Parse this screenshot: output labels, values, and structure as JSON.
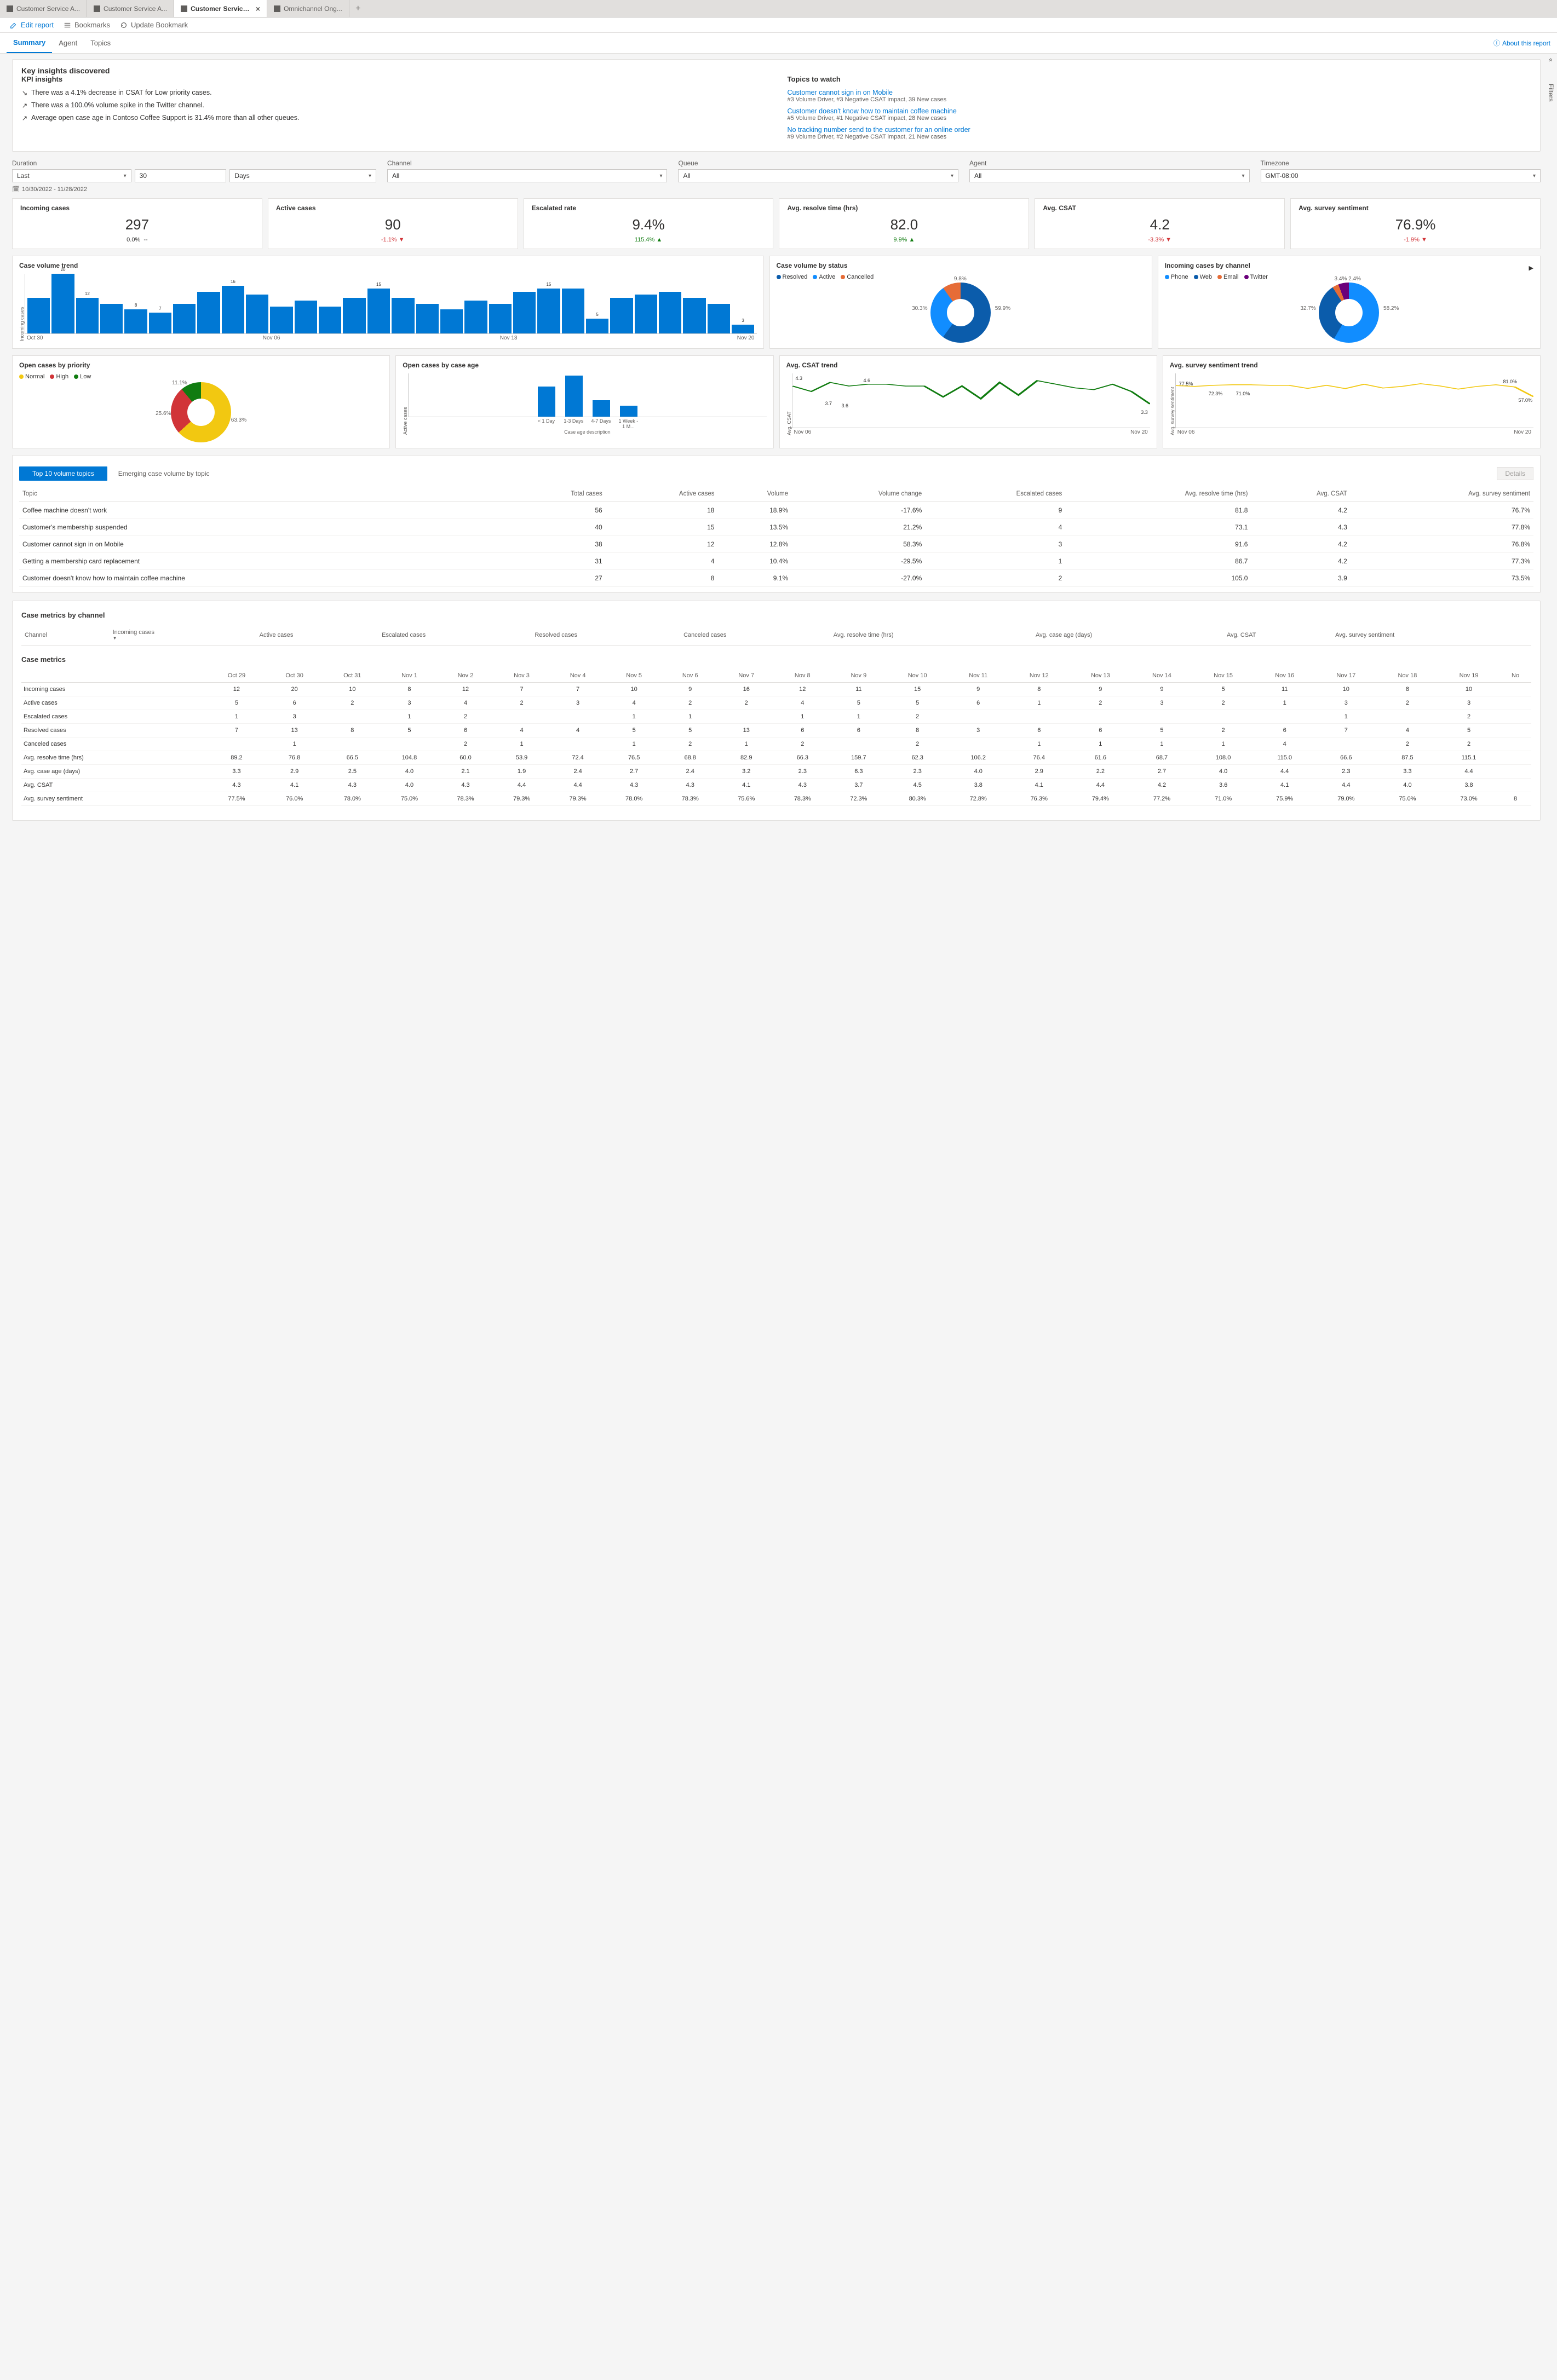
{
  "tabs": [
    {
      "label": "Customer Service A..."
    },
    {
      "label": "Customer Service A..."
    },
    {
      "label": "Customer Service historic...",
      "active": true
    },
    {
      "label": "Omnichannel Ong..."
    }
  ],
  "toolbar": {
    "edit": "Edit report",
    "bookmarks": "Bookmarks",
    "update": "Update Bookmark"
  },
  "subtabs": [
    "Summary",
    "Agent",
    "Topics"
  ],
  "about": "About this report",
  "insights": {
    "title": "Key insights discovered",
    "kpi_heading": "KPI insights",
    "kpis": [
      {
        "dir": "down",
        "text": "There was a 4.1% decrease in CSAT for Low priority cases."
      },
      {
        "dir": "up",
        "text": "There was a 100.0% volume spike in the Twitter channel."
      },
      {
        "dir": "up",
        "text": "Average open case age in Contoso Coffee Support is 31.4% more than all other queues."
      }
    ],
    "topics_heading": "Topics to watch",
    "topics": [
      {
        "title": "Customer cannot sign in on Mobile",
        "sub": "#3 Volume Driver, #3 Negative CSAT impact, 39 New cases"
      },
      {
        "title": "Customer doesn't know how to maintain coffee machine",
        "sub": "#5 Volume Driver, #1 Negative CSAT impact, 28 New cases"
      },
      {
        "title": "No tracking number send to the customer for an online order",
        "sub": "#9 Volume Driver, #2 Negative CSAT impact, 21 New cases"
      }
    ]
  },
  "filters": {
    "duration_label": "Duration",
    "duration_mode": "Last",
    "duration_value": "30",
    "duration_unit": "Days",
    "channel_label": "Channel",
    "channel_value": "All",
    "queue_label": "Queue",
    "queue_value": "All",
    "agent_label": "Agent",
    "agent_value": "All",
    "timezone_label": "Timezone",
    "timezone_value": "GMT-08:00",
    "range": "10/30/2022 - 11/28/2022"
  },
  "kpicards": [
    {
      "label": "Incoming cases",
      "value": "297",
      "delta": "0.0%",
      "deltaExtra": "--",
      "dir": "none"
    },
    {
      "label": "Active cases",
      "value": "90",
      "delta": "-1.1%",
      "dir": "down"
    },
    {
      "label": "Escalated rate",
      "value": "9.4%",
      "delta": "115.4%",
      "dir": "up"
    },
    {
      "label": "Avg. resolve time (hrs)",
      "value": "82.0",
      "delta": "9.9%",
      "dir": "up"
    },
    {
      "label": "Avg. CSAT",
      "value": "4.2",
      "delta": "-3.3%",
      "dir": "down"
    },
    {
      "label": "Avg. survey sentiment",
      "value": "76.9%",
      "delta": "-1.9%",
      "dir": "down"
    }
  ],
  "chart_data": {
    "case_volume_trend": {
      "type": "bar",
      "title": "Case volume trend",
      "ylabel": "Incoming cases",
      "ylim": [
        0,
        20
      ],
      "x_ticks": [
        "Oct 30",
        "Nov 06",
        "Nov 13",
        "Nov 20"
      ],
      "values": [
        12,
        20,
        12,
        10,
        8,
        7,
        10,
        14,
        16,
        13,
        9,
        11,
        9,
        12,
        15,
        12,
        10,
        8,
        11,
        10,
        14,
        15,
        15,
        5,
        12,
        13,
        14,
        12,
        10,
        3
      ],
      "labels_shown": {
        "1": "20",
        "2": "12",
        "5": "7",
        "8": "16",
        "14": "15",
        "21": "15",
        "23": "5",
        "29": "3",
        "4": "8"
      }
    },
    "case_volume_by_status": {
      "type": "pie",
      "title": "Case volume by status",
      "series": [
        {
          "name": "Resolved",
          "value": 59.9,
          "color": "#0b5cab"
        },
        {
          "name": "Active",
          "value": 30.3,
          "color": "#118dff"
        },
        {
          "name": "Cancelled",
          "value": 9.8,
          "color": "#e66c37"
        }
      ]
    },
    "incoming_by_channel": {
      "type": "pie",
      "title": "Incoming cases by channel",
      "series": [
        {
          "name": "Phone",
          "value": 58.2,
          "color": "#118dff"
        },
        {
          "name": "Web",
          "value": 32.7,
          "color": "#0b5cab"
        },
        {
          "name": "Email",
          "value": 3.4,
          "color": "#e66c37"
        },
        {
          "name": "Twitter",
          "value": 2.4,
          "color": "#6b007b"
        }
      ],
      "extra_label": "3.4%  2.4%"
    },
    "open_by_priority": {
      "type": "pie",
      "title": "Open cases by priority",
      "series": [
        {
          "name": "Normal",
          "value": 63.3,
          "color": "#f2c811"
        },
        {
          "name": "High",
          "value": 25.6,
          "color": "#d13438"
        },
        {
          "name": "Low",
          "value": 11.1,
          "color": "#107c10"
        }
      ]
    },
    "open_by_age": {
      "type": "bar",
      "title": "Open cases by case age",
      "ylabel": "Active cases",
      "ylim": [
        0,
        40
      ],
      "categories": [
        "< 1 Day",
        "1-3 Days",
        "4-7 Days",
        "1 Week - 1 M..."
      ],
      "values": [
        28,
        38,
        15,
        10
      ],
      "xlabel": "Case age description"
    },
    "csat_trend": {
      "type": "line",
      "title": "Avg. CSAT trend",
      "ylabel": "Avg. CSAT",
      "ylim": [
        2,
        5
      ],
      "x_ticks": [
        "Nov 06",
        "Nov 20"
      ],
      "annotations": [
        "4.3",
        "3.7",
        "3.6",
        "4.6",
        "3.3"
      ],
      "values": [
        4.3,
        4.0,
        4.5,
        4.3,
        4.4,
        4.4,
        4.3,
        4.3,
        3.7,
        4.3,
        3.6,
        4.5,
        3.8,
        4.6,
        4.4,
        4.2,
        4.1,
        4.4,
        4.0,
        3.3
      ]
    },
    "sentiment_trend": {
      "type": "line",
      "title": "Avg. survey sentiment trend",
      "ylabel": "Avg. survey sentiment",
      "ylim": [
        0,
        100
      ],
      "x_ticks": [
        "Nov 06",
        "Nov 20"
      ],
      "annotations": [
        "77.5%",
        "72.3%",
        "71.0%",
        "81.0%",
        "57.0%"
      ],
      "values": [
        77.5,
        76,
        78,
        79,
        79,
        78,
        78,
        72.3,
        78,
        72,
        80,
        73,
        76,
        81.0,
        77,
        71.0,
        76,
        79,
        75,
        57.0
      ]
    }
  },
  "topics_tabs": {
    "active": "Top 10 volume topics",
    "other": "Emerging case volume by topic",
    "details": "Details"
  },
  "topic_table": {
    "headers": [
      "Topic",
      "Total cases",
      "Active cases",
      "Volume",
      "Volume change",
      "Escalated cases",
      "Avg. resolve time (hrs)",
      "Avg. CSAT",
      "Avg. survey sentiment"
    ],
    "rows": [
      [
        "Coffee machine doesn't work",
        "56",
        "18",
        "18.9%",
        "-17.6%",
        "9",
        "81.8",
        "4.2",
        "76.7%"
      ],
      [
        "Customer's membership suspended",
        "40",
        "15",
        "13.5%",
        "21.2%",
        "4",
        "73.1",
        "4.3",
        "77.8%"
      ],
      [
        "Customer cannot sign in on Mobile",
        "38",
        "12",
        "12.8%",
        "58.3%",
        "3",
        "91.6",
        "4.2",
        "76.8%"
      ],
      [
        "Getting a membership card replacement",
        "31",
        "4",
        "10.4%",
        "-29.5%",
        "1",
        "86.7",
        "4.2",
        "77.3%"
      ],
      [
        "Customer doesn't know how to maintain coffee machine",
        "27",
        "8",
        "9.1%",
        "-27.0%",
        "2",
        "105.0",
        "3.9",
        "73.5%"
      ]
    ]
  },
  "metrics_by_channel": {
    "title": "Case metrics by channel",
    "headers": [
      "Channel",
      "Incoming cases",
      "Active cases",
      "Escalated cases",
      "Resolved cases",
      "Canceled cases",
      "Avg. resolve time (hrs)",
      "Avg. case age (days)",
      "Avg. CSAT",
      "Avg. survey sentiment"
    ]
  },
  "case_metrics": {
    "title": "Case metrics",
    "dates": [
      "Oct 29",
      "Oct 30",
      "Oct 31",
      "Nov 1",
      "Nov 2",
      "Nov 3",
      "Nov 4",
      "Nov 5",
      "Nov 6",
      "Nov 7",
      "Nov 8",
      "Nov 9",
      "Nov 10",
      "Nov 11",
      "Nov 12",
      "Nov 13",
      "Nov 14",
      "Nov 15",
      "Nov 16",
      "Nov 17",
      "Nov 18",
      "Nov 19",
      "No"
    ],
    "rows": [
      {
        "name": "Incoming cases",
        "v": [
          "12",
          "20",
          "10",
          "8",
          "12",
          "7",
          "7",
          "10",
          "9",
          "16",
          "12",
          "11",
          "15",
          "9",
          "8",
          "9",
          "9",
          "5",
          "11",
          "10",
          "8",
          "10",
          ""
        ]
      },
      {
        "name": "Active cases",
        "v": [
          "5",
          "6",
          "2",
          "3",
          "4",
          "2",
          "3",
          "4",
          "2",
          "2",
          "4",
          "5",
          "5",
          "6",
          "1",
          "2",
          "3",
          "2",
          "1",
          "3",
          "2",
          "3",
          ""
        ]
      },
      {
        "name": "Escalated cases",
        "v": [
          "1",
          "3",
          "",
          "1",
          "2",
          "",
          "",
          "1",
          "1",
          "",
          "1",
          "1",
          "2",
          "",
          "",
          "",
          "",
          "",
          "",
          "1",
          "",
          "2",
          ""
        ]
      },
      {
        "name": "Resolved cases",
        "v": [
          "7",
          "13",
          "8",
          "5",
          "6",
          "4",
          "4",
          "5",
          "5",
          "13",
          "6",
          "6",
          "8",
          "3",
          "6",
          "6",
          "5",
          "2",
          "6",
          "7",
          "4",
          "5",
          ""
        ]
      },
      {
        "name": "Canceled cases",
        "v": [
          "",
          "1",
          "",
          "",
          "2",
          "1",
          "",
          "1",
          "2",
          "1",
          "2",
          "",
          "2",
          "",
          "1",
          "1",
          "1",
          "1",
          "4",
          "",
          "2",
          "2",
          ""
        ]
      },
      {
        "name": "Avg. resolve time (hrs)",
        "v": [
          "89.2",
          "76.8",
          "66.5",
          "104.8",
          "60.0",
          "53.9",
          "72.4",
          "76.5",
          "68.8",
          "82.9",
          "66.3",
          "159.7",
          "62.3",
          "106.2",
          "76.4",
          "61.6",
          "68.7",
          "108.0",
          "115.0",
          "66.6",
          "87.5",
          "115.1",
          ""
        ]
      },
      {
        "name": "Avg. case age (days)",
        "v": [
          "3.3",
          "2.9",
          "2.5",
          "4.0",
          "2.1",
          "1.9",
          "2.4",
          "2.7",
          "2.4",
          "3.2",
          "2.3",
          "6.3",
          "2.3",
          "4.0",
          "2.9",
          "2.2",
          "2.7",
          "4.0",
          "4.4",
          "2.3",
          "3.3",
          "4.4",
          ""
        ]
      },
      {
        "name": "Avg. CSAT",
        "v": [
          "4.3",
          "4.1",
          "4.3",
          "4.0",
          "4.3",
          "4.4",
          "4.4",
          "4.3",
          "4.3",
          "4.1",
          "4.3",
          "3.7",
          "4.5",
          "3.8",
          "4.1",
          "4.4",
          "4.2",
          "3.6",
          "4.1",
          "4.4",
          "4.0",
          "3.8",
          ""
        ]
      },
      {
        "name": "Avg. survey sentiment",
        "v": [
          "77.5%",
          "76.0%",
          "78.0%",
          "75.0%",
          "78.3%",
          "79.3%",
          "79.3%",
          "78.0%",
          "78.3%",
          "75.6%",
          "78.3%",
          "72.3%",
          "80.3%",
          "72.8%",
          "76.3%",
          "79.4%",
          "77.2%",
          "71.0%",
          "75.9%",
          "79.0%",
          "75.0%",
          "73.0%",
          "8"
        ]
      }
    ]
  },
  "sidelabels": {
    "filters": "Filters",
    "ilters": "ilters",
    "filters2": "Filters"
  }
}
